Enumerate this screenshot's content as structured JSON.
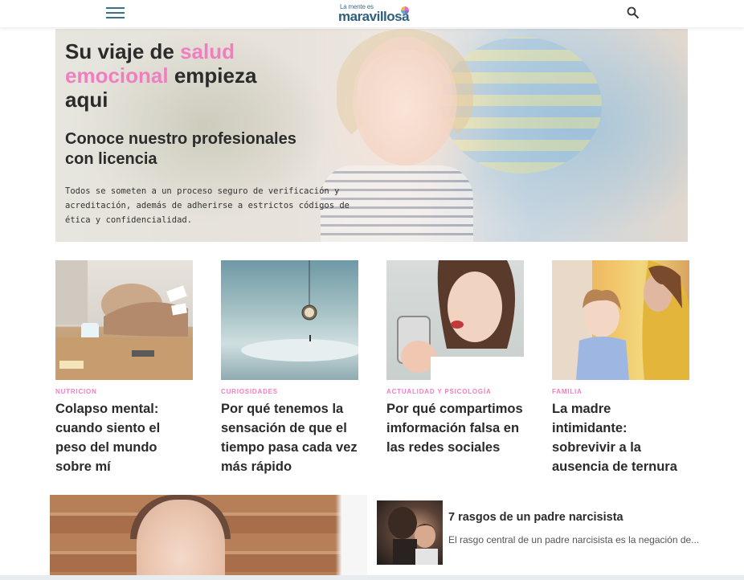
{
  "header": {
    "logo_small": "La mente es",
    "logo_main": "maravillosa",
    "menu_icon": "hamburger-menu-icon",
    "search_icon": "search-icon"
  },
  "hero": {
    "title_part1": "Su viaje de ",
    "title_highlight": "salud emocional",
    "title_part2": " empieza aqui",
    "subtitle": "Conoce nuestro profesionales con licencia",
    "description": "Todos se someten a un proceso seguro de verificación y acreditación, además de adherirse a estrictos códigos de ética y confidencialidad.",
    "highlight_color": "#ef7fbf"
  },
  "cards": [
    {
      "category": "NUTRICION",
      "title": "Colapso mental: cuando siento el peso del mundo sobre mí"
    },
    {
      "category": "CURIOSIDADES",
      "title": "Por qué tenemos la sensación de que el tiempo pasa cada vez más rápido"
    },
    {
      "category": "ACTUALIDAD Y PSICOLOGÍA",
      "title": "Por qué compartimos imformación falsa en las redes sociales"
    },
    {
      "category": "FAMILIA",
      "title": "La madre intimidante: sobrevivir a la ausencia de ternura"
    }
  ],
  "side_article": {
    "title": "7 rasgos de un padre narcisista",
    "excerpt": "El rasgo central de un padre narcisista es la negación de..."
  },
  "colors": {
    "accent_pink": "#ef7fbf",
    "brand_blue": "#2f5f7f",
    "text_dark": "#2b2b2b"
  }
}
